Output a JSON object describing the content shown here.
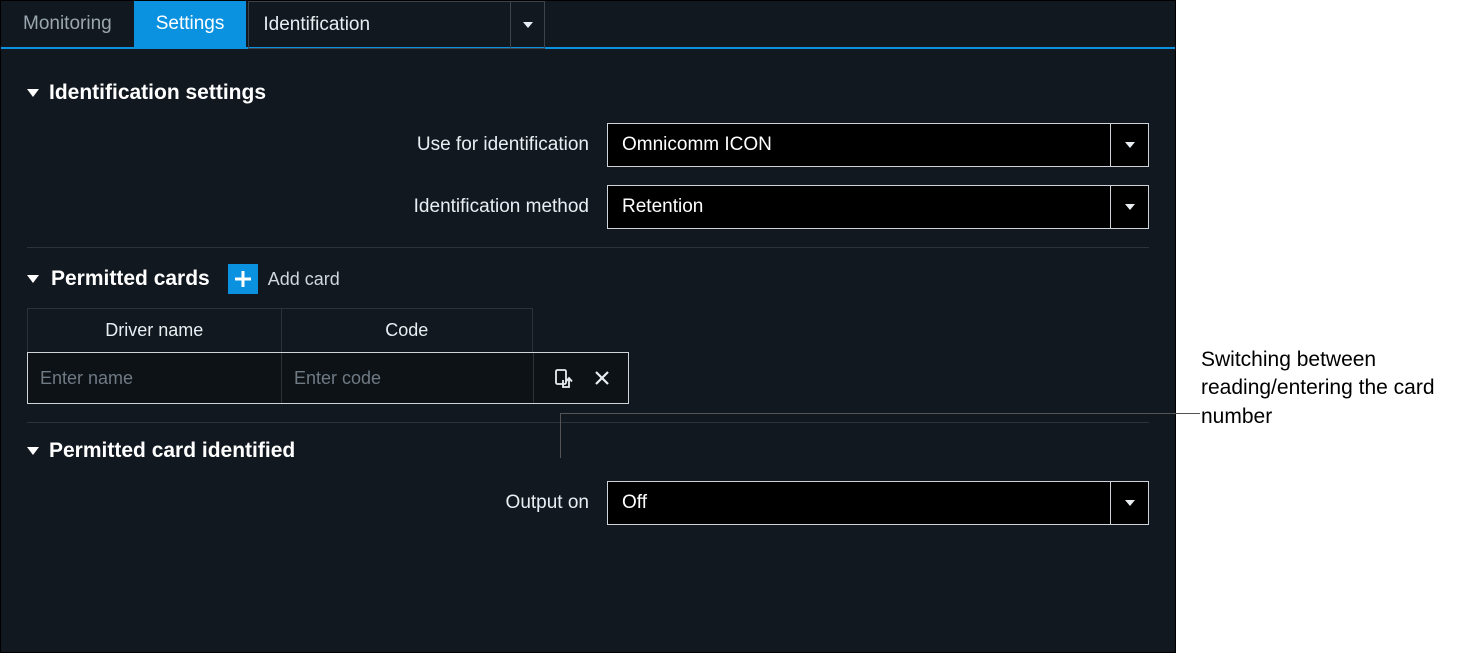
{
  "tabs": {
    "monitoring": "Monitoring",
    "settings": "Settings"
  },
  "submenu": {
    "label": "Identification"
  },
  "sections": {
    "identification": {
      "title": "Identification settings",
      "use_for_label": "Use for identification",
      "use_for_value": "Omnicomm ICON",
      "method_label": "Identification method",
      "method_value": "Retention"
    },
    "permitted": {
      "title": "Permitted cards",
      "add_label": "Add card",
      "columns": {
        "name": "Driver name",
        "code": "Code"
      },
      "row": {
        "name_placeholder": "Enter name",
        "code_placeholder": "Enter code"
      }
    },
    "identified": {
      "title": "Permitted card identified",
      "output_label": "Output on",
      "output_value": "Off"
    }
  },
  "annotation": "Switching between reading/entering the card number"
}
